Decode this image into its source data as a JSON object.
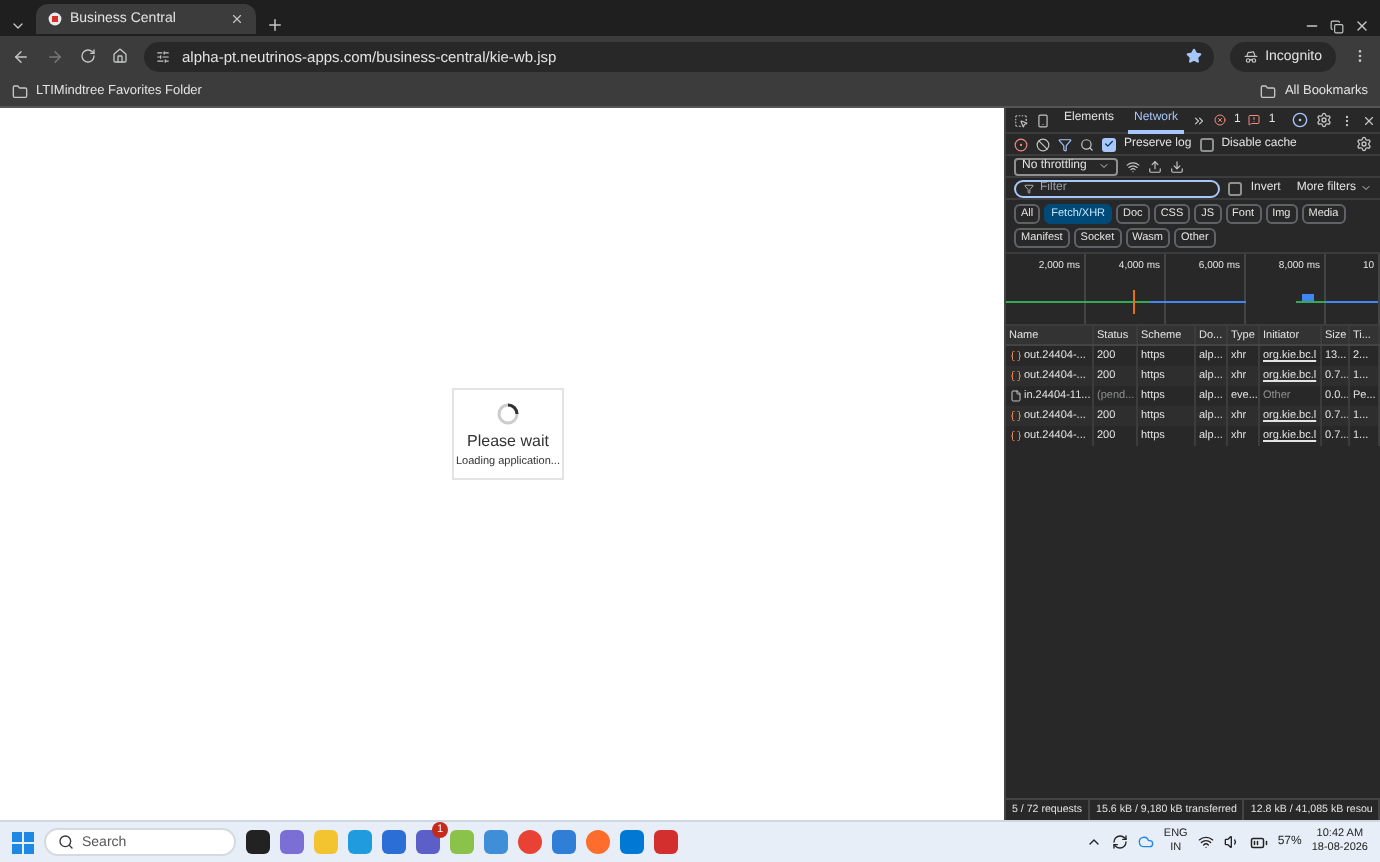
{
  "browser": {
    "tab_title": "Business Central",
    "url": "alpha-pt.neutrinos-apps.com/business-central/kie-wb.jsp",
    "profile": "Incognito",
    "bookmarks": [
      "LTIMindtree Favorites Folder"
    ],
    "all_bookmarks": "All Bookmarks"
  },
  "page": {
    "loader_title": "Please wait",
    "loader_subtitle": "Loading application..."
  },
  "devtools": {
    "tabs": [
      {
        "label": "Elements",
        "selected": false
      },
      {
        "label": "Network",
        "selected": true
      }
    ],
    "error_count": "1",
    "issue_count": "1",
    "preserve_log": {
      "label": "Preserve log",
      "checked": true
    },
    "disable_cache": {
      "label": "Disable cache",
      "checked": false
    },
    "throttling": "No throttling",
    "filter": {
      "placeholder": "Filter"
    },
    "invert": {
      "label": "Invert",
      "checked": false
    },
    "more_filters": "More filters",
    "type_filters": [
      {
        "label": "All",
        "selected": false
      },
      {
        "label": "Fetch/XHR",
        "selected": true
      },
      {
        "label": "Doc",
        "selected": false
      },
      {
        "label": "CSS",
        "selected": false
      },
      {
        "label": "JS",
        "selected": false
      },
      {
        "label": "Font",
        "selected": false
      },
      {
        "label": "Img",
        "selected": false
      },
      {
        "label": "Media",
        "selected": false
      },
      {
        "label": "Manifest",
        "selected": false
      },
      {
        "label": "Socket",
        "selected": false
      },
      {
        "label": "Wasm",
        "selected": false
      },
      {
        "label": "Other",
        "selected": false
      }
    ],
    "timeline_ticks": [
      "2,000 ms",
      "4,000 ms",
      "6,000 ms",
      "8,000 ms",
      "10"
    ],
    "columns": [
      "Name",
      "Status",
      "Scheme",
      "Do...",
      "Type",
      "Initiator",
      "Size",
      "Ti..."
    ],
    "rows": [
      {
        "kind": "xhr",
        "cells": [
          "out.24404-...",
          "200",
          "https",
          "alp...",
          "xhr",
          "org.kie.bc.l",
          "13...",
          "2..."
        ]
      },
      {
        "kind": "xhr",
        "cells": [
          "out.24404-...",
          "200",
          "https",
          "alp...",
          "xhr",
          "org.kie.bc.l",
          "0.7...",
          "1..."
        ]
      },
      {
        "kind": "eventsource",
        "cells": [
          "in.24404-11...",
          "(pend...",
          "https",
          "alp...",
          "eve...",
          "Other",
          "0.0...",
          "Pe..."
        ]
      },
      {
        "kind": "xhr",
        "cells": [
          "out.24404-...",
          "200",
          "https",
          "alp...",
          "xhr",
          "org.kie.bc.l",
          "0.7...",
          "1..."
        ]
      },
      {
        "kind": "xhr",
        "cells": [
          "out.24404-...",
          "200",
          "https",
          "alp...",
          "xhr",
          "org.kie.bc.l",
          "0.7...",
          "1..."
        ]
      }
    ],
    "status_bar": [
      "5 / 72 requests",
      "15.6 kB / 9,180 kB transferred",
      "12.8 kB / 41,085 kB resou"
    ]
  },
  "taskbar": {
    "search": {
      "placeholder": "Search"
    },
    "teams_badge": "1",
    "language": "ENG",
    "region": "IN",
    "battery": "57%",
    "time": "10:42 AM",
    "date": "18-08-2026"
  }
}
